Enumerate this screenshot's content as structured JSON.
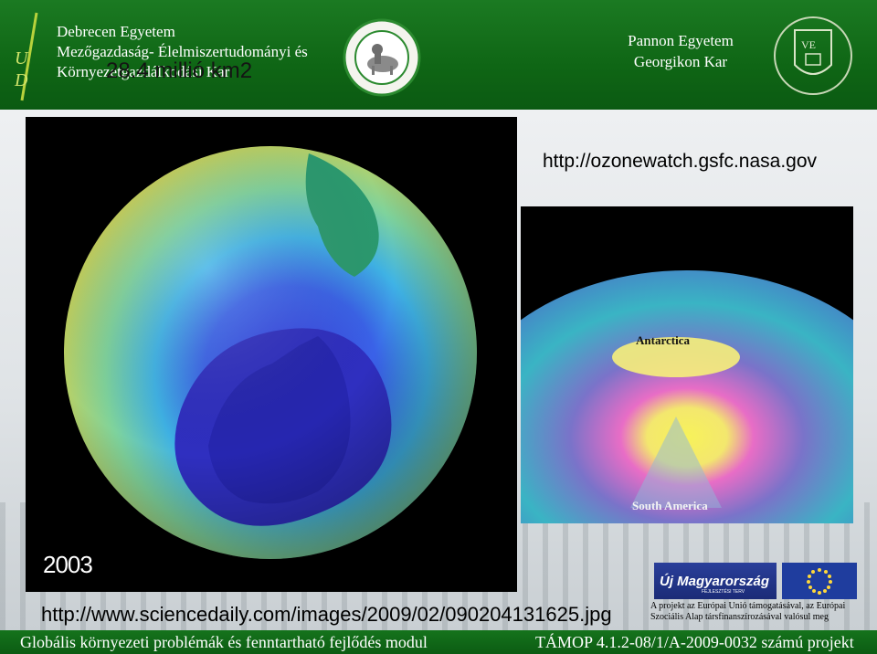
{
  "header": {
    "university_lines": [
      "Debrecen Egyetem",
      "Mezőgazdaság- Élelmiszertudományi és",
      "Környezetgazdálkodási Kar"
    ],
    "overlay_text": "28.4 millió km2",
    "pannon_lines": [
      "Pannon Egyetem",
      "Georgikon Kar"
    ]
  },
  "slide": {
    "url_top": "http://ozonewatch.gsfc.nasa.gov",
    "globe_year": "2003",
    "map_labels": {
      "top": "Antarctica",
      "bottom": "South America"
    },
    "url_bottom": "http://www.sciencedaily.com/images/2009/02/090204131625.jpg"
  },
  "logos": {
    "um_title": "Új Magyarország",
    "um_subtitle": "FEJLESZTÉSI TERV",
    "eu_text": "A projekt az Európai Unió támogatásával, az Európai Szociális Alap társfinanszírozásával valósul meg"
  },
  "footer": {
    "left": "Globális környezeti problémák és fenntartható fejlődés modul",
    "right": "TÁMOP 4.1.2-08/1/A-2009-0032 számú projekt"
  },
  "colors": {
    "header_green": "#0f6615",
    "ozone_hole": "#2a2fc2",
    "eu_blue": "#1f3d9e"
  }
}
